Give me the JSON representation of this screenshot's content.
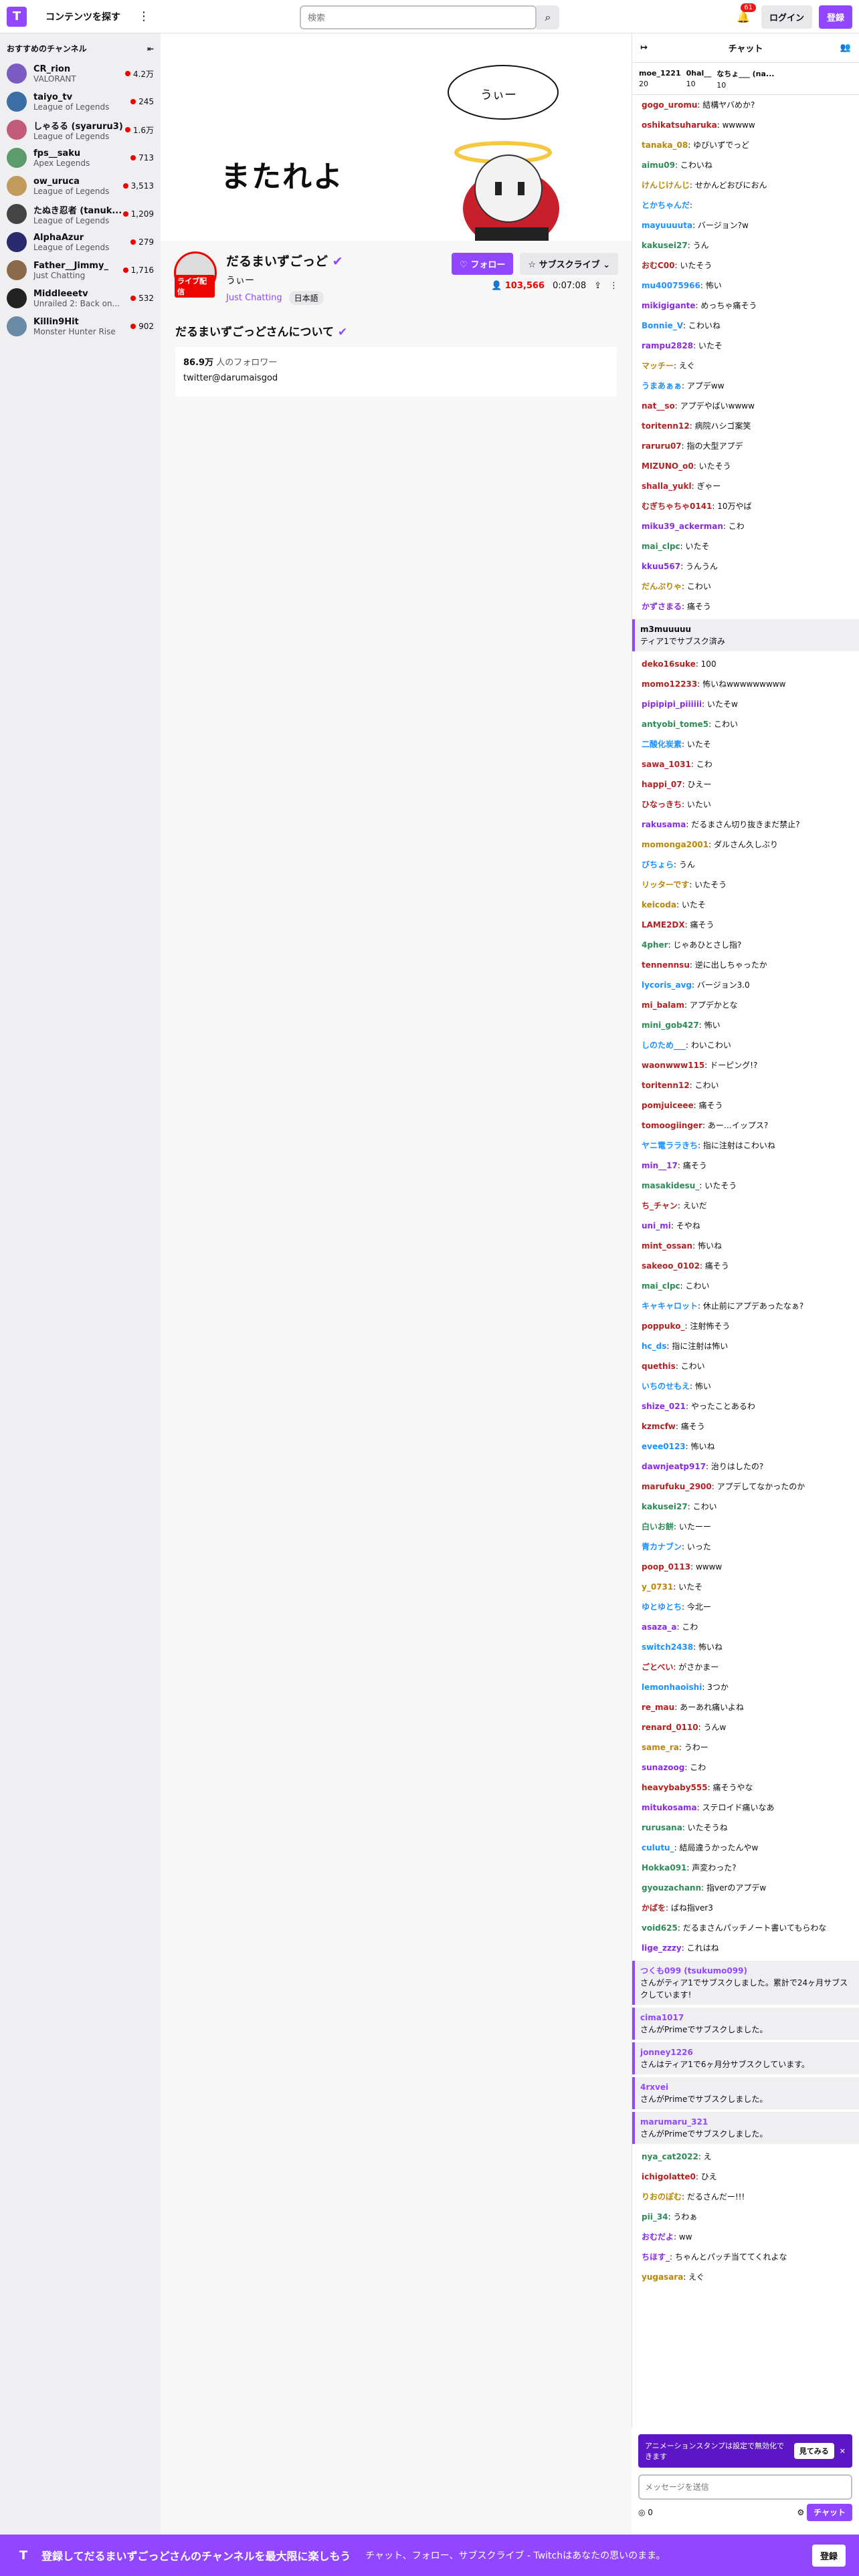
{
  "nav": {
    "browse": "コンテンツを探す",
    "search_placeholder": "検索",
    "notif_count": "61",
    "login": "ログイン",
    "signup": "登録"
  },
  "sidebar": {
    "title": "おすすめのチャンネル",
    "channels": [
      {
        "name": "CR_rion",
        "game": "VALORANT",
        "viewers": "4.2万",
        "color": "#7a5cc2"
      },
      {
        "name": "taiyo_tv",
        "game": "League of Legends",
        "viewers": "245",
        "color": "#3a6ea5"
      },
      {
        "name": "しゃるる (syaruru3)",
        "game": "League of Legends",
        "viewers": "1.6万",
        "color": "#c25c7a"
      },
      {
        "name": "fps__saku",
        "game": "Apex Legends",
        "viewers": "713",
        "color": "#5c9c6a"
      },
      {
        "name": "ow_uruca",
        "game": "League of Legends",
        "viewers": "3,513",
        "color": "#c29a5c"
      },
      {
        "name": "たぬき忍者 (tanuk...",
        "game": "League of Legends",
        "viewers": "1,209",
        "color": "#444"
      },
      {
        "name": "AlphaAzur",
        "game": "League of Legends",
        "viewers": "279",
        "color": "#2a2a6e"
      },
      {
        "name": "Father__Jimmy_",
        "game": "Just Chatting",
        "viewers": "1,716",
        "color": "#8a6a4a"
      },
      {
        "name": "Middleeetv",
        "game": "Unrailed 2: Back on...",
        "viewers": "532",
        "color": "#222"
      },
      {
        "name": "Killin9Hit",
        "game": "Monster Hunter Rise",
        "viewers": "902",
        "color": "#6a8aa5"
      }
    ]
  },
  "player": {
    "overlay_text": "またれよ",
    "bubble_text": "うぃー"
  },
  "stream": {
    "name": "だるまいずごっど",
    "title": "うぃー",
    "category": "Just Chatting",
    "tag": "日本語",
    "live": "ライブ配信",
    "follow": "フォロー",
    "subscribe": "サブスクライブ",
    "viewers": "103,566",
    "uptime": "0:07:08"
  },
  "about": {
    "heading": "だるまいずごっどさんについて",
    "followers": "86.9万",
    "followers_label": "人のフォロワー",
    "twitter": "twitter@darumaisgod"
  },
  "chat": {
    "header": "チャット",
    "leaderboard": [
      {
        "name": "moe_1221",
        "count": "20"
      },
      {
        "name": "0hal__",
        "count": "10"
      },
      {
        "name": "なちょ___ (na...",
        "count": "10"
      }
    ],
    "messages": [
      {
        "user": "gogo_uromu",
        "text": "結構ヤバめか?",
        "color": "#b22222"
      },
      {
        "user": "oshikatsuharuka",
        "text": "wwwww",
        "color": "#b22222"
      },
      {
        "user": "tanaka_08",
        "text": "ゆびいずでっど",
        "color": "#b8860b"
      },
      {
        "user": "aimu09",
        "text": "こわいね",
        "color": "#2e8b57"
      },
      {
        "user": "けんじけんじ",
        "text": "せかんどおびにおん",
        "color": "#b8860b"
      },
      {
        "user": "とかちゃんだ",
        "text": "",
        "color": "#1e90ff"
      },
      {
        "user": "mayuuuuta",
        "text": "バージョン?w",
        "color": "#1e90ff"
      },
      {
        "user": "kakusei27",
        "text": "うん",
        "color": "#2e8b57"
      },
      {
        "user": "おむC00",
        "text": "いたそう",
        "color": "#b22222"
      },
      {
        "user": "mu40075966",
        "text": "怖い",
        "color": "#1e90ff"
      },
      {
        "user": "mikigigante",
        "text": "めっちゃ痛そう",
        "color": "#8a2be2"
      },
      {
        "user": "Bonnie_V",
        "text": "こわいね",
        "color": "#1e90ff"
      },
      {
        "user": "rampu2828",
        "text": "いたそ",
        "color": "#8a2be2"
      },
      {
        "user": "マッチー",
        "text": "えぐ",
        "color": "#b8860b"
      },
      {
        "user": "うまあぁぁ",
        "text": "アプデww",
        "color": "#1e90ff"
      },
      {
        "user": "nat__so",
        "text": "アプデやばいwwww",
        "color": "#b22222"
      },
      {
        "user": "toritenn12",
        "text": "病院ハシゴ案笑",
        "color": "#b22222"
      },
      {
        "user": "raruru07",
        "text": "指の大型アプデ",
        "color": "#b22222"
      },
      {
        "user": "MIZUNO_o0",
        "text": "いたそう",
        "color": "#b22222"
      },
      {
        "user": "shalla_yukl",
        "text": "ぎゃー",
        "color": "#b22222"
      },
      {
        "user": "むぎちゃちゃ0141",
        "text": "10万やば",
        "color": "#b22222"
      },
      {
        "user": "miku39_ackerman",
        "text": "こわ",
        "color": "#8a2be2"
      },
      {
        "user": "mai_clpc",
        "text": "いたそ",
        "color": "#2e8b57"
      },
      {
        "user": "kkuu567",
        "text": "うんうん",
        "color": "#8a2be2"
      },
      {
        "user": "だんぷりゃ",
        "text": "こわい",
        "color": "#b8860b"
      },
      {
        "user": "かずさまる",
        "text": "痛そう",
        "color": "#8a2be2"
      }
    ],
    "sub_event": {
      "user": "m3muuuuu",
      "text": "ティア1でサブスク済み"
    },
    "messages2": [
      {
        "user": "deko16suke",
        "text": "100",
        "color": "#b22222"
      },
      {
        "user": "momo12233",
        "text": "怖いねwwwwwwwww",
        "color": "#b22222"
      },
      {
        "user": "pipipipi_piiiiii",
        "text": "いたそw",
        "color": "#8a2be2"
      },
      {
        "user": "antyobi_tome5",
        "text": "こわい",
        "color": "#2e8b57"
      },
      {
        "user": "二酸化炭素",
        "text": "いたそ",
        "color": "#1e90ff"
      },
      {
        "user": "sawa_1031",
        "text": "こわ",
        "color": "#b22222"
      },
      {
        "user": "happi_07",
        "text": "ひえー",
        "color": "#b22222"
      },
      {
        "user": "ひなっきち",
        "text": "いたい",
        "color": "#b22222"
      },
      {
        "user": "rakusama",
        "text": "だるまさん切り抜きまだ禁止?",
        "color": "#8a2be2"
      },
      {
        "user": "momonga2001",
        "text": "ダルさん久しぶり",
        "color": "#b8860b"
      },
      {
        "user": "びちょら",
        "text": "うん",
        "color": "#1e90ff"
      },
      {
        "user": "リッターです",
        "text": "いたそう",
        "color": "#b8860b"
      },
      {
        "user": "keicoda",
        "text": "いたそ",
        "color": "#b8860b"
      },
      {
        "user": "LAME2DX",
        "text": "痛そう",
        "color": "#b22222"
      },
      {
        "user": "4pher",
        "text": "じゃあひとさし指?",
        "color": "#2e8b57"
      },
      {
        "user": "tennennsu",
        "text": "逆に出しちゃったか",
        "color": "#b22222"
      },
      {
        "user": "lycoris_avg",
        "text": "バージョン3.0",
        "color": "#1e90ff"
      },
      {
        "user": "mi_balam",
        "text": "アプデかとな",
        "color": "#b22222"
      },
      {
        "user": "mini_gob427",
        "text": "怖い",
        "color": "#2e8b57"
      },
      {
        "user": "しのため___",
        "text": "わいこわい",
        "color": "#1e90ff"
      },
      {
        "user": "waonwww115",
        "text": "ドーピング!?",
        "color": "#b22222"
      },
      {
        "user": "toritenn12",
        "text": "こわい",
        "color": "#b22222"
      },
      {
        "user": "pomjuiceee",
        "text": "痛そう",
        "color": "#b22222"
      },
      {
        "user": "tomoogiinger",
        "text": "あー…イップス?",
        "color": "#b22222"
      },
      {
        "user": "ヤニ電ララきち",
        "text": "指に注射はこわいね",
        "color": "#1e90ff"
      },
      {
        "user": "min__17",
        "text": "痛そう",
        "color": "#8a2be2"
      },
      {
        "user": "masakidesu_",
        "text": "いたそう",
        "color": "#2e8b57"
      },
      {
        "user": "ち_チャン",
        "text": "えいだ",
        "color": "#b22222"
      },
      {
        "user": "uni_mi",
        "text": "そやね",
        "color": "#8a2be2"
      },
      {
        "user": "mint_ossan",
        "text": "怖いね",
        "color": "#b22222"
      },
      {
        "user": "sakeoo_0102",
        "text": "痛そう",
        "color": "#b22222"
      },
      {
        "user": "mai_clpc",
        "text": "こわい",
        "color": "#2e8b57"
      },
      {
        "user": "キャキャロット",
        "text": "休止前にアプデあったなぁ?",
        "color": "#1e90ff"
      },
      {
        "user": "poppuko_",
        "text": "注射怖そう",
        "color": "#b22222"
      },
      {
        "user": "hc_ds",
        "text": "指に注射は怖い",
        "color": "#1e90ff"
      },
      {
        "user": "quethis",
        "text": "こわい",
        "color": "#b22222"
      },
      {
        "user": "いちのせもえ",
        "text": "怖い",
        "color": "#1e90ff"
      },
      {
        "user": "shize_021",
        "text": "やったことあるわ",
        "color": "#8a2be2"
      },
      {
        "user": "kzmcfw",
        "text": "痛そう",
        "color": "#b22222"
      },
      {
        "user": "evee0123",
        "text": "怖いね",
        "color": "#1e90ff"
      },
      {
        "user": "dawnjeatp917",
        "text": "治りはしたの?",
        "color": "#8a2be2"
      },
      {
        "user": "marufuku_2900",
        "text": "アプデしてなかったのか",
        "color": "#b22222"
      },
      {
        "user": "kakusei27",
        "text": "こわい",
        "color": "#2e8b57"
      },
      {
        "user": "白いお餅",
        "text": "いたーー",
        "color": "#2e8b57"
      },
      {
        "user": "青カナブン",
        "text": "いった",
        "color": "#1e90ff"
      },
      {
        "user": "poop_0113",
        "text": "wwww",
        "color": "#b22222"
      },
      {
        "user": "y_0731",
        "text": "いたそ",
        "color": "#b8860b"
      },
      {
        "user": "ゆとゆとち",
        "text": "今北ー",
        "color": "#1e90ff"
      },
      {
        "user": "asaza_a",
        "text": "こわ",
        "color": "#8a2be2"
      },
      {
        "user": "switch2438",
        "text": "怖いね",
        "color": "#1e90ff"
      },
      {
        "user": "ごとべい",
        "text": "がさかまー",
        "color": "#b22222"
      },
      {
        "user": "lemonhaoishi",
        "text": "3つか",
        "color": "#1e90ff"
      },
      {
        "user": "re_mau",
        "text": "あーあれ痛いよね",
        "color": "#b22222"
      },
      {
        "user": "renard_0110",
        "text": "うんw",
        "color": "#b22222"
      },
      {
        "user": "same_ra",
        "text": "うわー",
        "color": "#b8860b"
      },
      {
        "user": "sunazoog",
        "text": "こわ",
        "color": "#8a2be2"
      },
      {
        "user": "heavybaby555",
        "text": "痛そうやな",
        "color": "#b22222"
      },
      {
        "user": "mitukosama",
        "text": "ステロイド痛いなあ",
        "color": "#8a2be2"
      },
      {
        "user": "rurusana",
        "text": "いたそうね",
        "color": "#2e8b57"
      },
      {
        "user": "culutu_",
        "text": "結局違うかったんやw",
        "color": "#1e90ff"
      },
      {
        "user": "Hokka091",
        "text": "声変わった?",
        "color": "#2e8b57"
      },
      {
        "user": "gyouzachann",
        "text": "指verのアプデw",
        "color": "#2e8b57"
      },
      {
        "user": "かばを",
        "text": "ばね指ver3",
        "color": "#b22222"
      },
      {
        "user": "void625",
        "text": "だるまさんパッチノート書いてもらわな",
        "color": "#2e8b57"
      },
      {
        "user": "lige_zzzy",
        "text": "これはね",
        "color": "#8a2be2"
      }
    ],
    "events": [
      {
        "user": "つくも099 (tsukumo099)",
        "text": "さんがティア1でサブスクしました。累計で24ヶ月サブスクしています!"
      },
      {
        "user": "cima1017",
        "text": "さんがPrimeでサブスクしました。"
      },
      {
        "user": "jonney1226",
        "text": "さんはティア1で6ヶ月分サブスクしています。"
      },
      {
        "user": "4rxvei",
        "text": "さんがPrimeでサブスクしました。"
      },
      {
        "user": "marumaru_321",
        "text": "さんがPrimeでサブスクしました。"
      }
    ],
    "messages3": [
      {
        "user": "nya_cat2022",
        "text": "え",
        "color": "#2e8b57"
      },
      {
        "user": "ichigolatte0",
        "text": "ひえ",
        "color": "#b22222"
      },
      {
        "user": "りおのぽむ",
        "text": "だるさんだー!!!",
        "color": "#b8860b"
      },
      {
        "user": "pii_34",
        "text": "うわぁ",
        "color": "#2e8b57"
      },
      {
        "user": "おむだよ",
        "text": "ww",
        "color": "#8a2be2"
      },
      {
        "user": "ちほす_",
        "text": "ちゃんとパッチ当ててくれよな",
        "color": "#8a2be2"
      },
      {
        "user": "yugasara",
        "text": "えぐ",
        "color": "#b8860b"
      }
    ],
    "notice": "アニメーションスタンプは設定で無効化できます",
    "see": "見てみる",
    "input_placeholder": "メッセージを送信",
    "points": "0",
    "chat_button": "チャット"
  },
  "footer": {
    "title": "登録してだるまいずごっどさんのチャンネルを最大限に楽しもう",
    "text": "チャット、フォロー、サブスクライブ - Twitchはあなたの思いのまま。",
    "button": "登録"
  }
}
